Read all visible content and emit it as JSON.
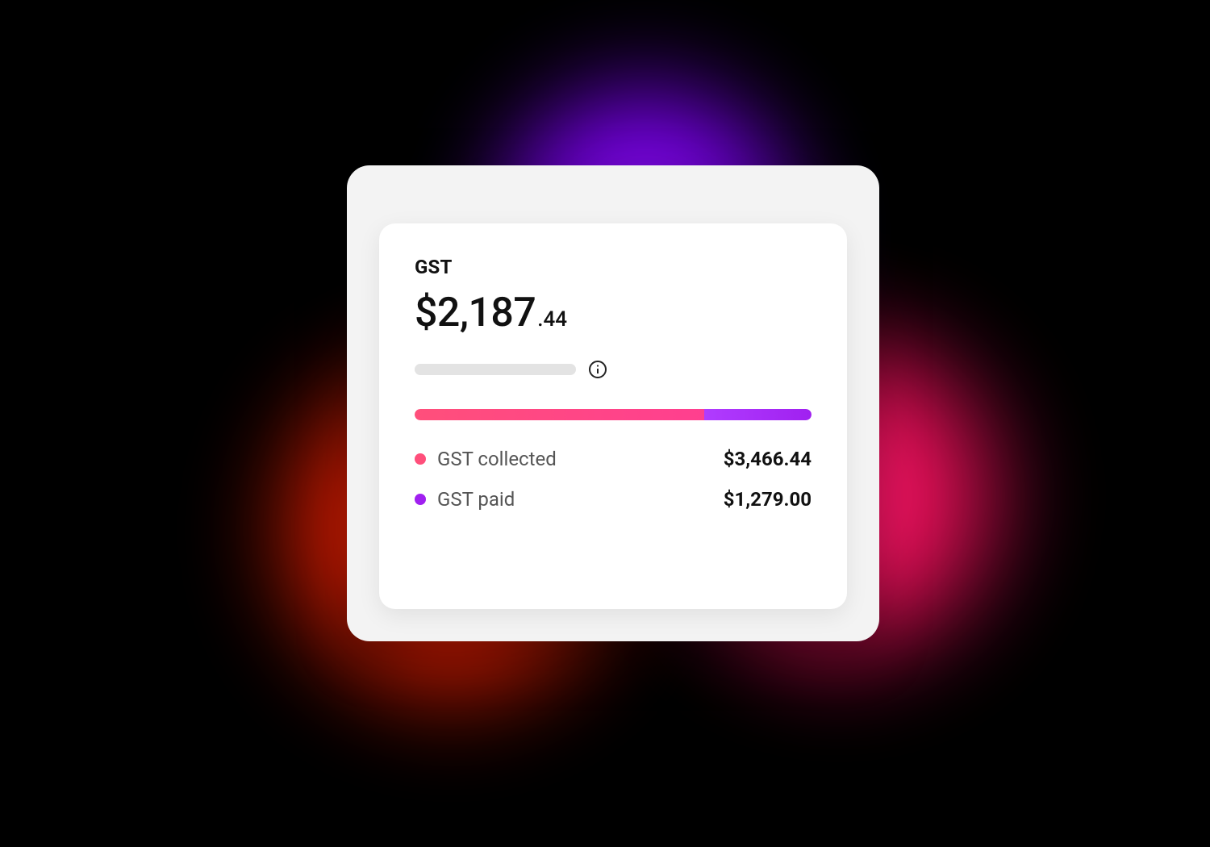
{
  "card": {
    "title": "GST",
    "amount_major": "$2,187",
    "amount_minor": ".44"
  },
  "chart_data": {
    "type": "bar",
    "categories": [
      "GST collected",
      "GST paid"
    ],
    "values": [
      3466.44,
      1279.0
    ],
    "title": "GST",
    "colors": {
      "collected": "#ff4f7b",
      "paid": "#a020f0"
    }
  },
  "legend": {
    "collected": {
      "label": "GST collected",
      "value": "$3,466.44"
    },
    "paid": {
      "label": "GST paid",
      "value": "$1,279.00"
    }
  }
}
